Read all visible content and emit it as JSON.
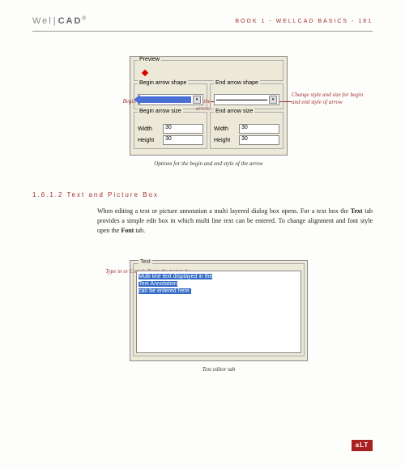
{
  "header": {
    "logo_well": "Wel",
    "logo_cad": "CAD",
    "title": "BOOK 1 - WELLCAD BASICS - 181"
  },
  "dialog1": {
    "preview_label": "Preview",
    "begin_shape_label": "Begin arrow shape",
    "end_shape_label": "End arrow shape",
    "begin_size_label": "Begin arrow size",
    "end_size_label": "End arrow size",
    "width_label": "Width",
    "height_label": "Height",
    "begin_width": "30",
    "begin_height": "30",
    "end_width": "30",
    "end_height": "30"
  },
  "annotations": {
    "left1": "Begin is where you clicked to draw the arrow.",
    "right1": "Change style and size for begin and end style of arrow",
    "left2": "Type in or Copy'n Paste the text to be displayed"
  },
  "captions": {
    "c1": "Options for the begin and end style of the arrow",
    "c2": "Text editor tab"
  },
  "section": {
    "heading": "1.6.1.2 Text and Picture Box",
    "body_pre": "When editing a text or picture annotation a multi layered dialog box opens. For a text box the ",
    "body_b1": "Text",
    "body_mid": " tab provides a simple edit box in which multi line text can be entered. To change alignment and font style open the ",
    "body_b2": "Font",
    "body_end": " tab."
  },
  "dialog2": {
    "group_label": "Text",
    "line1": "Multi line text displayed in the",
    "line2": "Text Annotation",
    "line3": "can be entered here."
  },
  "footer": {
    "logo": "aLT"
  }
}
